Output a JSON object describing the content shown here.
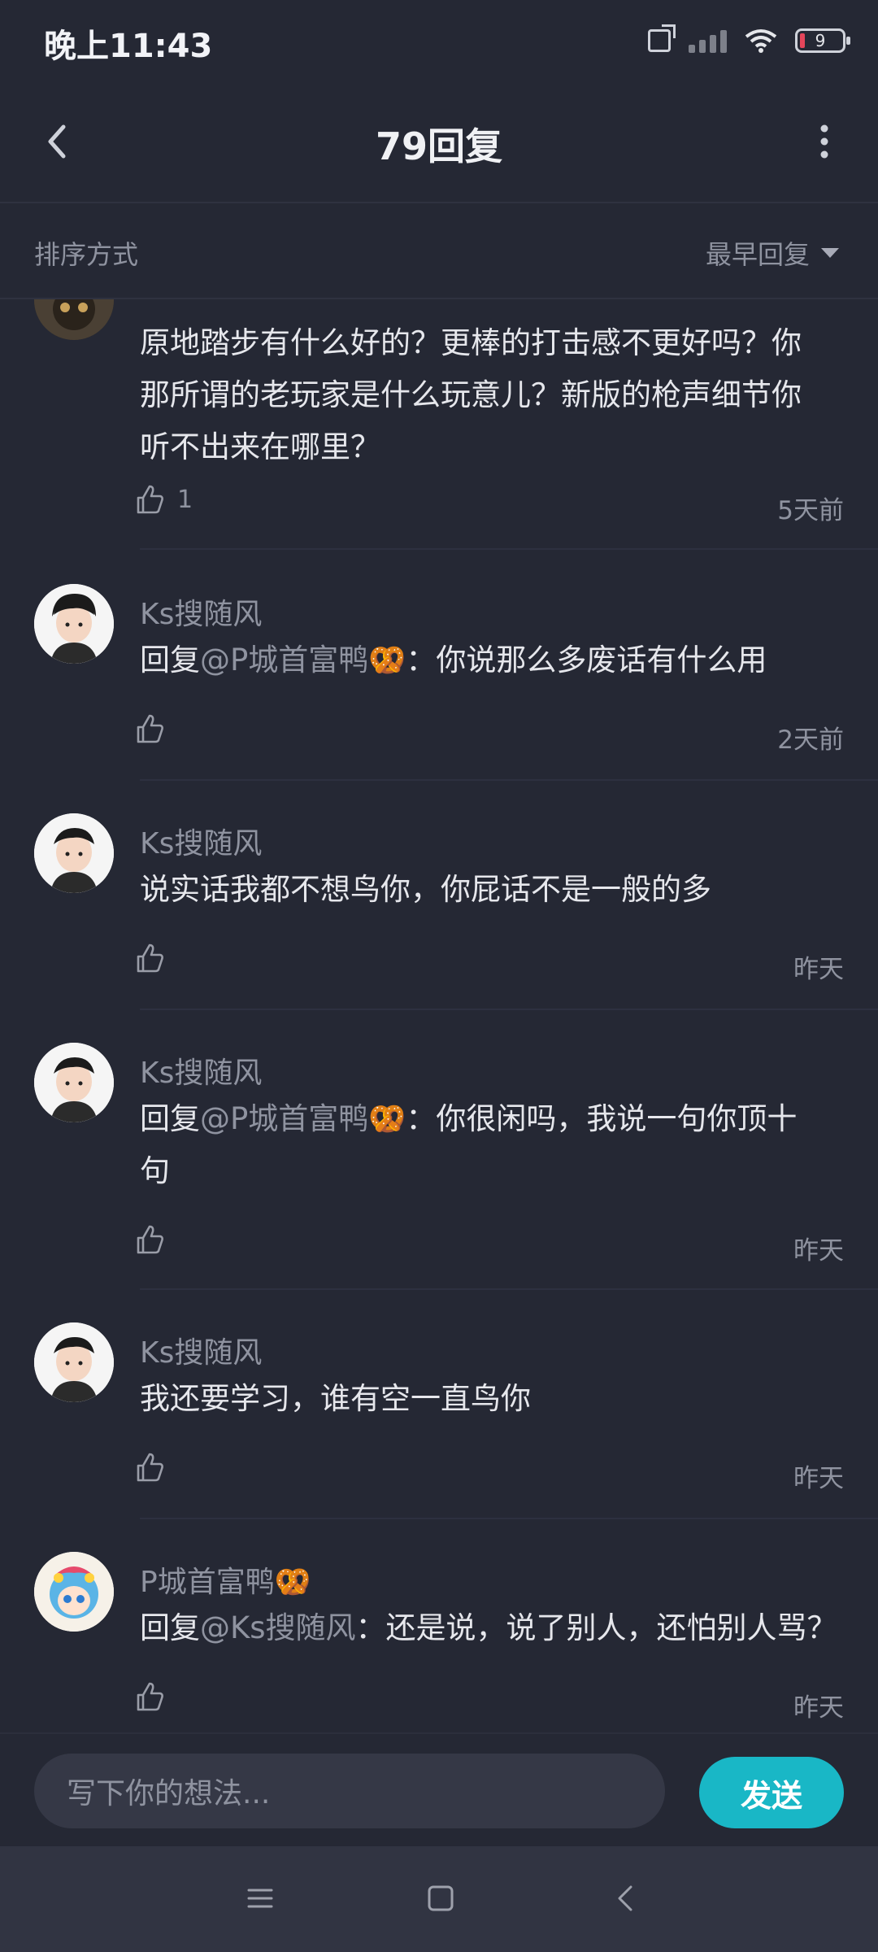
{
  "status": {
    "time": "晚上11:43",
    "battery": "9"
  },
  "header": {
    "title": "79回复"
  },
  "sort": {
    "label": "排序方式",
    "value": "最早回复"
  },
  "comments": [
    {
      "content_text": "原地踏步有什么好的？更棒的打击感不更好吗？你那所谓的老玩家是什么玩意儿？新版的枪声细节你听不出来在哪里？",
      "likes": "1",
      "time": "5天前"
    },
    {
      "name": "Ks搜随风",
      "reply_prefix": "回复",
      "mention": "@P城首富鸭🥨",
      "content_text": "：你说那么多废话有什么用",
      "likes": "",
      "time": "2天前"
    },
    {
      "name": "Ks搜随风",
      "content_text": "说实话我都不想鸟你，你屁话不是一般的多",
      "likes": "",
      "time": "昨天"
    },
    {
      "name": "Ks搜随风",
      "reply_prefix": "回复",
      "mention": "@P城首富鸭🥨",
      "content_text": "：你很闲吗，我说一句你顶十句",
      "likes": "",
      "time": "昨天"
    },
    {
      "name": "Ks搜随风",
      "content_text": "我还要学习，谁有空一直鸟你",
      "likes": "",
      "time": "昨天"
    },
    {
      "name": "P城首富鸭🥨",
      "reply_prefix": "回复",
      "mention": "@Ks搜随风",
      "content_text": "：还是说，说了别人，还怕别人骂？",
      "likes": "",
      "time": "昨天"
    }
  ],
  "composer": {
    "placeholder": "写下你的想法...",
    "send_label": "发送"
  },
  "icons": {
    "back": "chevron-left-icon",
    "more": "more-vertical-icon",
    "like": "thumbs-up-icon",
    "nav_menu": "menu-icon",
    "nav_home": "square-icon",
    "nav_back": "back-icon"
  },
  "colors": {
    "background": "#252834",
    "accent": "#19b7c6",
    "muted_text": "#8f93a0"
  }
}
